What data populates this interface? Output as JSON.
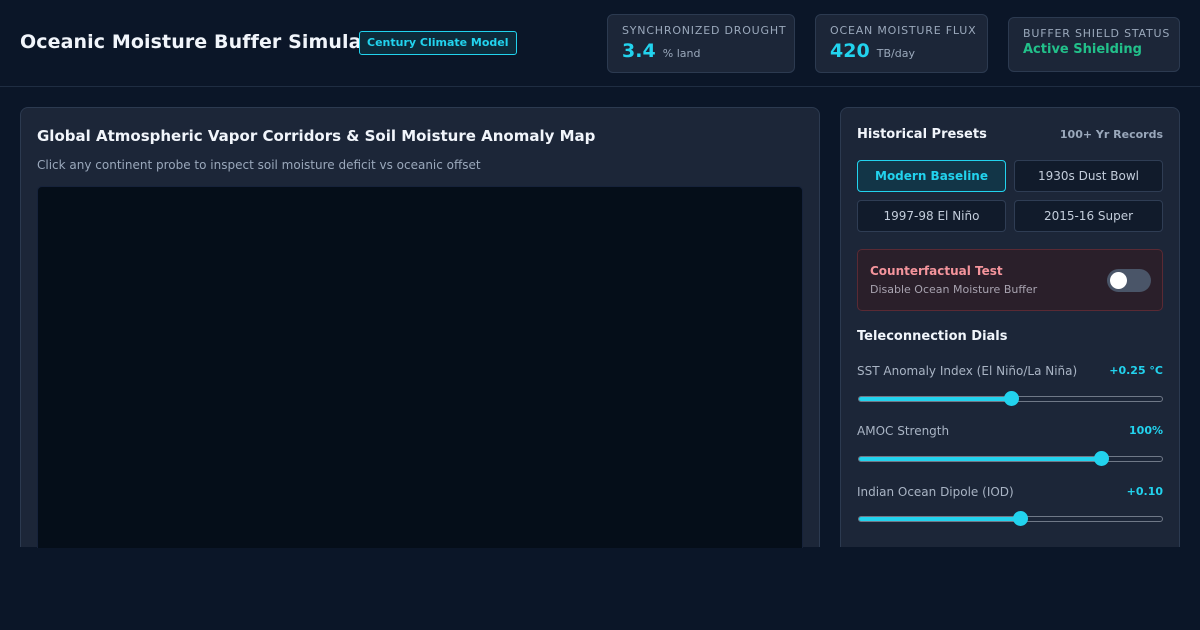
{
  "header": {
    "title": "Oceanic Moisture Buffer Simulator",
    "badge": "Century Climate Model"
  },
  "stats": {
    "drought": {
      "label": "SYNCHRONIZED DROUGHT",
      "value": "3.4",
      "unit": "% land"
    },
    "flux": {
      "label": "OCEAN MOISTURE FLUX",
      "value": "420",
      "unit": "TB/day"
    },
    "shield": {
      "label": "BUFFER SHIELD STATUS",
      "status": "Active Shielding"
    }
  },
  "map": {
    "title": "Global Atmospheric Vapor Corridors & Soil Moisture Anomaly Map",
    "subtitle": "Click any continent probe to inspect soil moisture deficit vs oceanic offset"
  },
  "presets": {
    "title": "Historical Presets",
    "records": "100+ Yr Records",
    "items": [
      {
        "label": "Modern Baseline",
        "active": true
      },
      {
        "label": "1930s Dust Bowl",
        "active": false
      },
      {
        "label": "1997-98 El Niño",
        "active": false
      },
      {
        "label": "2015-16 Super",
        "active": false
      }
    ]
  },
  "counterfactual": {
    "title": "Counterfactual Test",
    "subtitle": "Disable Ocean Moisture Buffer",
    "enabled": false
  },
  "dials": {
    "title": "Teleconnection Dials",
    "items": [
      {
        "label": "SST Anomaly Index (El Niño/La Niña)",
        "value": "+0.25 °C",
        "fraction": 0.5
      },
      {
        "label": "AMOC Strength",
        "value": "100%",
        "fraction": 0.8
      },
      {
        "label": "Indian Ocean Dipole (IOD)",
        "value": "+0.10",
        "fraction": 0.53
      }
    ]
  },
  "colors": {
    "accent": "#22d3ee",
    "status_ok": "#22c08a",
    "warning": "#f4949c",
    "background": "#0b1628",
    "panel": "#1c2638"
  }
}
